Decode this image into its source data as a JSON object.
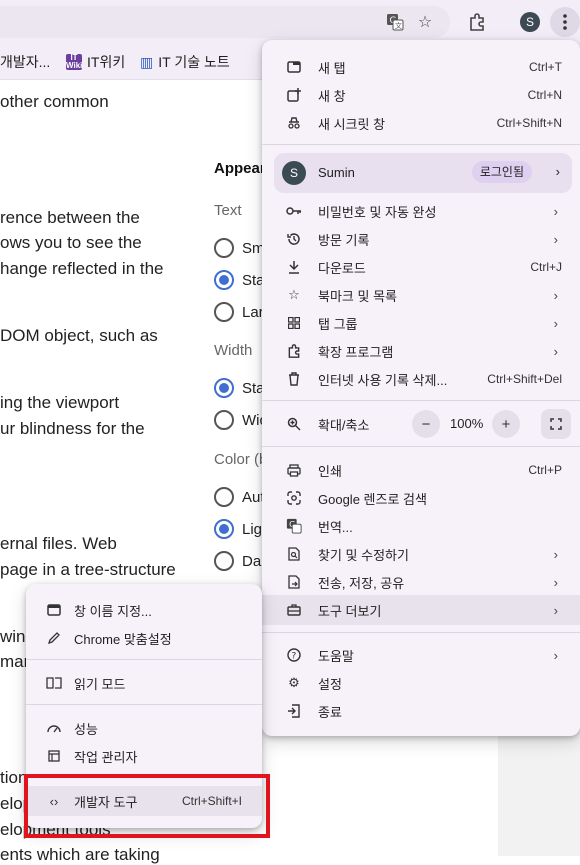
{
  "toolbar": {
    "avatar_letter": "S",
    "translate_icon": "translate-icon",
    "star_icon": "star-icon",
    "extensions_icon": "puzzle-icon",
    "menu_icon": "vertical-dots-icon"
  },
  "bookmarks": [
    {
      "label": "개발자...",
      "icon": "globe-icon"
    },
    {
      "label": "IT위키",
      "icon": "itwiki-icon"
    },
    {
      "label": "IT 기술 노트",
      "icon": "book-icon"
    }
  ],
  "page": {
    "lines": [
      "other common",
      "rence between the",
      "ows you to see the",
      "hange reflected in the",
      "DOM object, such as",
      "ing the viewport",
      "ur blindness for the",
      "ernal files. Web",
      "page in a tree-structure",
      "wing",
      "mar",
      "tion.",
      "elop",
      "elopment tools",
      "ents which are taking"
    ],
    "appearance_heading": "Appear",
    "text_label": "Text",
    "text_options": [
      "Sm",
      "Sta",
      "Lar"
    ],
    "width_label": "Width",
    "width_options": [
      "Sta",
      "Wic"
    ],
    "color_label": "Color (b",
    "color_options": [
      "Aut",
      "Lig",
      "Dar"
    ]
  },
  "main_menu": {
    "new_tab": {
      "label": "새 탭",
      "shortcut": "Ctrl+T"
    },
    "new_window": {
      "label": "새 창",
      "shortcut": "Ctrl+N"
    },
    "incognito": {
      "label": "새 시크릿 창",
      "shortcut": "Ctrl+Shift+N"
    },
    "profile": {
      "name": "Sumin",
      "badge": "로그인됨",
      "letter": "S"
    },
    "passwords": {
      "label": "비밀번호 및 자동 완성"
    },
    "history": {
      "label": "방문 기록"
    },
    "downloads": {
      "label": "다운로드",
      "shortcut": "Ctrl+J"
    },
    "bookmarks": {
      "label": "북마크 및 목록"
    },
    "tab_groups": {
      "label": "탭 그룹"
    },
    "extensions": {
      "label": "확장 프로그램"
    },
    "clear_data": {
      "label": "인터넷 사용 기록 삭제...",
      "shortcut": "Ctrl+Shift+Del"
    },
    "zoom": {
      "label": "확대/축소",
      "value": "100%"
    },
    "print": {
      "label": "인쇄",
      "shortcut": "Ctrl+P"
    },
    "lens": {
      "label": "Google 렌즈로 검색"
    },
    "translate": {
      "label": "번역..."
    },
    "find": {
      "label": "찾기 및 수정하기"
    },
    "share": {
      "label": "전송, 저장, 공유"
    },
    "more_tools": {
      "label": "도구 더보기"
    },
    "help": {
      "label": "도움말"
    },
    "settings": {
      "label": "설정"
    },
    "exit": {
      "label": "종료"
    }
  },
  "sub_menu": {
    "name_window": {
      "label": "창 이름 지정..."
    },
    "customize": {
      "label": "Chrome 맞춤설정"
    },
    "reading_mode": {
      "label": "읽기 모드"
    },
    "performance": {
      "label": "성능"
    },
    "task_manager": {
      "label": "작업 관리자"
    },
    "dev_tools": {
      "label": "개발자 도구",
      "shortcut": "Ctrl+Shift+I"
    }
  },
  "colors": {
    "accent": "#3f6fd1",
    "highlight_border": "#e0141e",
    "menu_bg": "#f7f2fa"
  }
}
